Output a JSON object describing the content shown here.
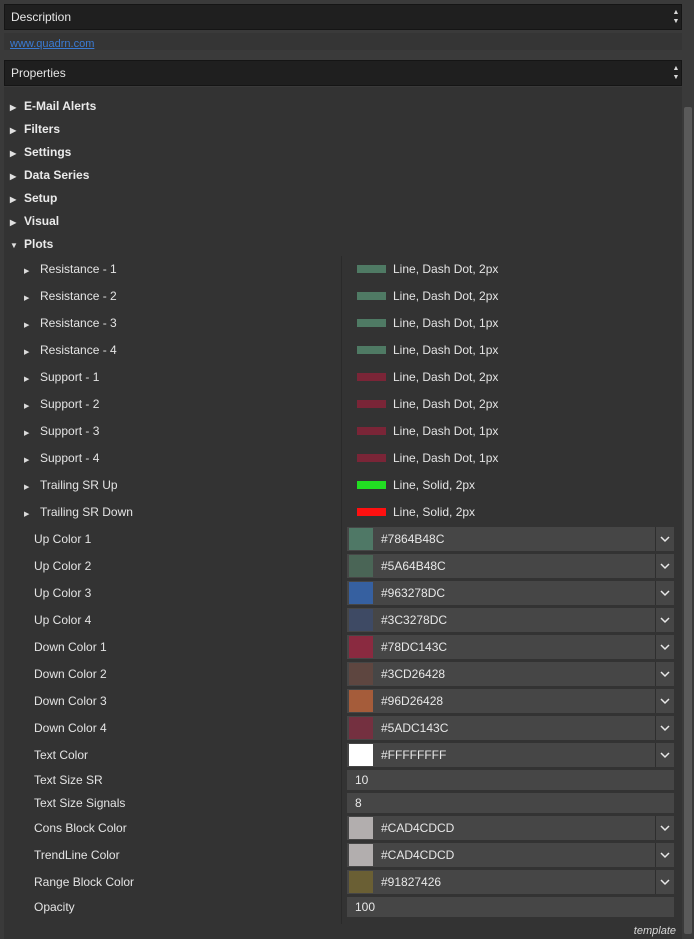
{
  "description": {
    "title": "Description",
    "link_text": "www.quadrn.com"
  },
  "properties": {
    "title": "Properties",
    "categories": [
      {
        "label": "E-Mail Alerts",
        "expanded": false
      },
      {
        "label": "Filters",
        "expanded": false
      },
      {
        "label": "Settings",
        "expanded": false
      },
      {
        "label": "Data Series",
        "expanded": false
      },
      {
        "label": "Setup",
        "expanded": false
      },
      {
        "label": "Visual",
        "expanded": false
      },
      {
        "label": "Plots",
        "expanded": true
      }
    ],
    "plots": [
      {
        "label": "Resistance - 1",
        "value": "Line, Dash Dot, 2px",
        "color": "#4f7a64"
      },
      {
        "label": "Resistance - 2",
        "value": "Line, Dash Dot, 2px",
        "color": "#4f7a64"
      },
      {
        "label": "Resistance - 3",
        "value": "Line, Dash Dot, 1px",
        "color": "#4f7a64"
      },
      {
        "label": "Resistance - 4",
        "value": "Line, Dash Dot, 1px",
        "color": "#4f7a64"
      },
      {
        "label": "Support - 1",
        "value": "Line, Dash Dot, 2px",
        "color": "#7a2537"
      },
      {
        "label": "Support - 2",
        "value": "Line, Dash Dot, 2px",
        "color": "#7a2537"
      },
      {
        "label": "Support - 3",
        "value": "Line, Dash Dot, 1px",
        "color": "#7a2537"
      },
      {
        "label": "Support - 4",
        "value": "Line, Dash Dot, 1px",
        "color": "#7a2537"
      },
      {
        "label": "Trailing SR Up",
        "value": "Line, Solid, 2px",
        "color": "#22dd22"
      },
      {
        "label": "Trailing SR Down",
        "value": "Line, Solid, 2px",
        "color": "#ff1010"
      }
    ],
    "colors": [
      {
        "label": "Up Color 1",
        "hex": "#7864B48C",
        "swatch": "#4f7866"
      },
      {
        "label": "Up Color 2",
        "hex": "#5A64B48C",
        "swatch": "#4a6556"
      },
      {
        "label": "Up Color 3",
        "hex": "#963278DC",
        "swatch": "#3660a0"
      },
      {
        "label": "Up Color 4",
        "hex": "#3C3278DC",
        "swatch": "#3e4a64"
      },
      {
        "label": "Down Color 1",
        "hex": "#78DC143C",
        "swatch": "#8a2a40"
      },
      {
        "label": "Down Color 2",
        "hex": "#3CD26428",
        "swatch": "#5e4640"
      },
      {
        "label": "Down Color 3",
        "hex": "#96D26428",
        "swatch": "#a55c3a"
      },
      {
        "label": "Down Color 4",
        "hex": "#5ADC143C",
        "swatch": "#743040"
      },
      {
        "label": "Text Color",
        "hex": "#FFFFFFFF",
        "swatch": "#ffffff"
      }
    ],
    "text_size_sr": {
      "label": "Text Size SR",
      "value": "10"
    },
    "text_size_signals": {
      "label": "Text Size Signals",
      "value": "8"
    },
    "colors2": [
      {
        "label": "Cons Block Color",
        "hex": "#CAD4CDCD",
        "swatch": "#b2aeae"
      },
      {
        "label": "TrendLine Color",
        "hex": "#CAD4CDCD",
        "swatch": "#b2aeae"
      },
      {
        "label": "Range Block Color",
        "hex": "#91827426",
        "swatch": "#6a5f34"
      }
    ],
    "opacity": {
      "label": "Opacity",
      "value": "100"
    }
  },
  "footer": {
    "label": "template"
  }
}
